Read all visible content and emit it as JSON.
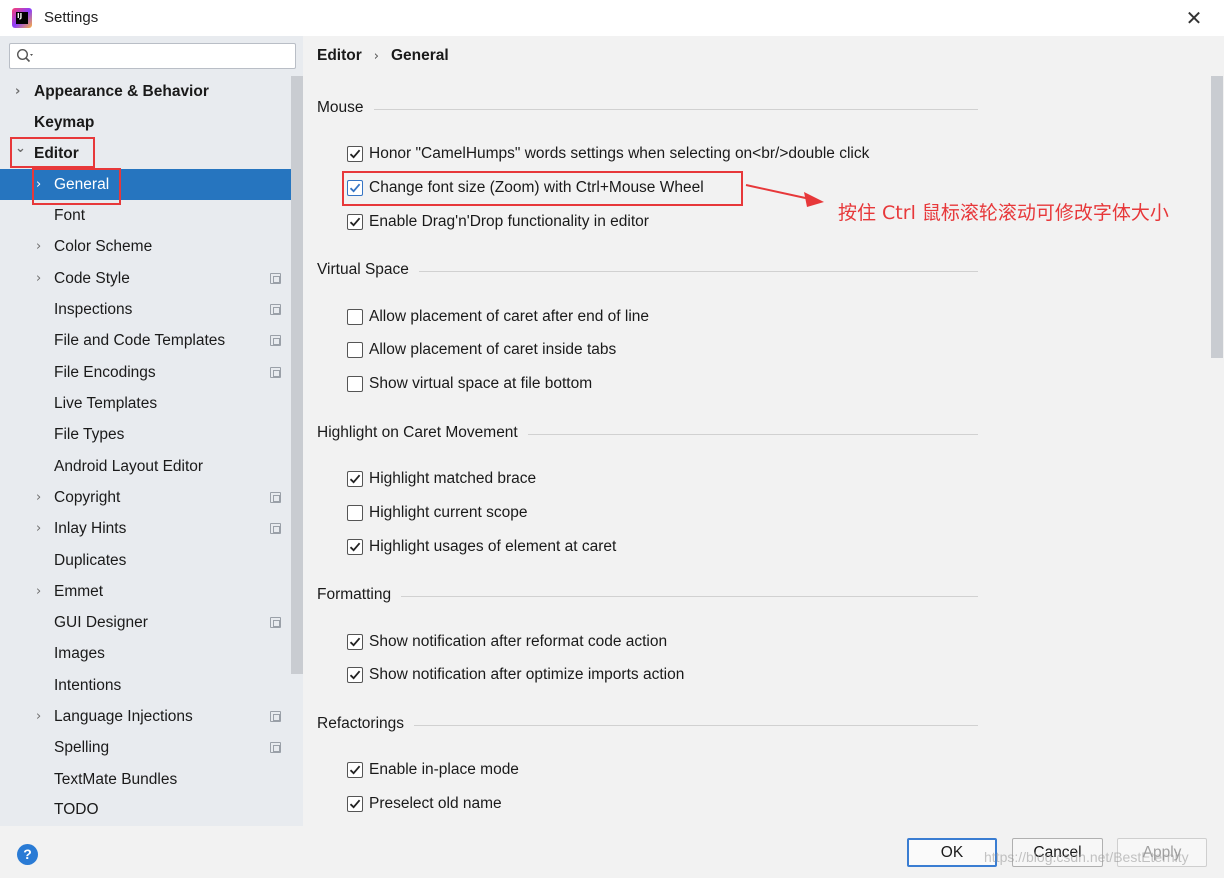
{
  "window": {
    "title": "Settings",
    "close_glyph": "✕"
  },
  "search": {
    "placeholder": ""
  },
  "sidebar": {
    "items": [
      {
        "label": "Appearance & Behavior",
        "bold": true,
        "expandable": true,
        "level": 0
      },
      {
        "label": "Keymap",
        "bold": true,
        "expandable": false,
        "level": 0
      },
      {
        "label": "Editor",
        "bold": true,
        "expandable": true,
        "expanded": true,
        "level": 0
      },
      {
        "label": "General",
        "expandable": true,
        "selected": true,
        "level": 1
      },
      {
        "label": "Font",
        "expandable": false,
        "level": 1
      },
      {
        "label": "Color Scheme",
        "expandable": true,
        "level": 1
      },
      {
        "label": "Code Style",
        "expandable": true,
        "project": true,
        "level": 1
      },
      {
        "label": "Inspections",
        "expandable": false,
        "project": true,
        "level": 1
      },
      {
        "label": "File and Code Templates",
        "expandable": false,
        "project": true,
        "level": 1
      },
      {
        "label": "File Encodings",
        "expandable": false,
        "project": true,
        "level": 1
      },
      {
        "label": "Live Templates",
        "expandable": false,
        "level": 1
      },
      {
        "label": "File Types",
        "expandable": false,
        "level": 1
      },
      {
        "label": "Android Layout Editor",
        "expandable": false,
        "level": 1
      },
      {
        "label": "Copyright",
        "expandable": true,
        "project": true,
        "level": 1
      },
      {
        "label": "Inlay Hints",
        "expandable": true,
        "project": true,
        "level": 1
      },
      {
        "label": "Duplicates",
        "expandable": false,
        "level": 1
      },
      {
        "label": "Emmet",
        "expandable": true,
        "level": 1
      },
      {
        "label": "GUI Designer",
        "expandable": false,
        "project": true,
        "level": 1
      },
      {
        "label": "Images",
        "expandable": false,
        "level": 1
      },
      {
        "label": "Intentions",
        "expandable": false,
        "level": 1
      },
      {
        "label": "Language Injections",
        "expandable": true,
        "project": true,
        "level": 1
      },
      {
        "label": "Spelling",
        "expandable": false,
        "project": true,
        "level": 1
      },
      {
        "label": "TextMate Bundles",
        "expandable": false,
        "level": 1
      },
      {
        "label": "TODO",
        "expandable": false,
        "level": 1
      }
    ]
  },
  "breadcrumb": {
    "part1": "Editor",
    "sep": "›",
    "part2": "General"
  },
  "sections": [
    {
      "title": "Mouse",
      "options": [
        {
          "label": "Honor \"CamelHumps\" words settings when selecting on<br/>double click",
          "checked": true
        },
        {
          "label": "Change font size (Zoom) with Ctrl+Mouse Wheel",
          "checked": true,
          "highlighted": true
        },
        {
          "label": "Enable Drag'n'Drop functionality in editor",
          "checked": true
        }
      ]
    },
    {
      "title": "Virtual Space",
      "options": [
        {
          "label": "Allow placement of caret after end of line",
          "checked": false
        },
        {
          "label": "Allow placement of caret inside tabs",
          "checked": false
        },
        {
          "label": "Show virtual space at file bottom",
          "checked": false
        }
      ]
    },
    {
      "title": "Highlight on Caret Movement",
      "options": [
        {
          "label": "Highlight matched brace",
          "checked": true
        },
        {
          "label": "Highlight current scope",
          "checked": false
        },
        {
          "label": "Highlight usages of element at caret",
          "checked": true
        }
      ]
    },
    {
      "title": "Formatting",
      "options": [
        {
          "label": "Show notification after reformat code action",
          "checked": true
        },
        {
          "label": "Show notification after optimize imports action",
          "checked": true
        }
      ]
    },
    {
      "title": "Refactorings",
      "options": [
        {
          "label": "Enable in-place mode",
          "checked": true
        },
        {
          "label": "Preselect old name",
          "checked": true
        }
      ]
    }
  ],
  "annotation": {
    "text": "按住 Ctrl 鼠标滚轮滚动可修改字体大小"
  },
  "footer": {
    "help": "?",
    "ok": "OK",
    "cancel": "Cancel",
    "apply": "Apply",
    "watermark": "https://blog.csdn.net/BestEternity"
  },
  "colors": {
    "accent": "#2675bf",
    "annotation": "#e7383a",
    "check": "#3574c4"
  }
}
